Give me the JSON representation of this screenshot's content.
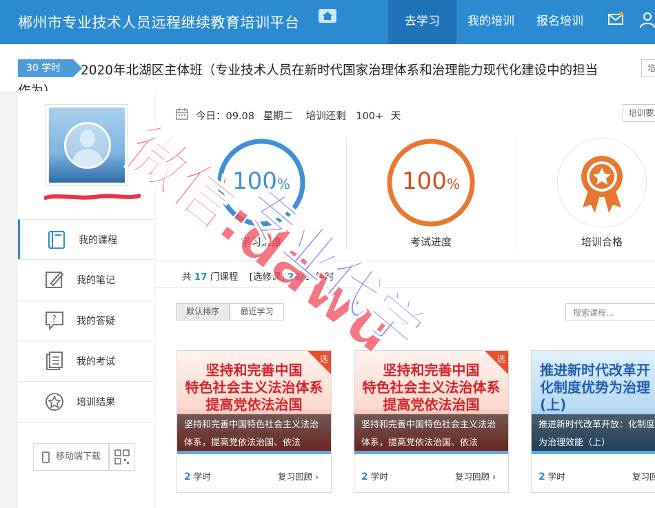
{
  "header": {
    "logo": "郴州市专业技术人员远程继续教育培训平台",
    "nav": [
      {
        "label": "去学习",
        "active": true
      },
      {
        "label": "我的培训",
        "active": false
      },
      {
        "label": "报名培训",
        "active": false
      }
    ]
  },
  "course": {
    "hours_tag": "30 学时",
    "title_line1": "2020年北湖区主体班（专业技术人员在新时代国家治理体系和治理能力现代化建设中的担当",
    "title_line2": "作为）",
    "top_btn": "培"
  },
  "sidebar": {
    "menu": [
      {
        "label": "我的课程",
        "icon": "book-icon",
        "active": true
      },
      {
        "label": "我的笔记",
        "icon": "edit-icon",
        "active": false
      },
      {
        "label": "我的答疑",
        "icon": "question-icon",
        "active": false
      },
      {
        "label": "我的考试",
        "icon": "exam-icon",
        "active": false
      },
      {
        "label": "培训结果",
        "icon": "star-badge-icon",
        "active": false
      }
    ],
    "mobile_download": "移动端下载"
  },
  "summary": {
    "today": "今日：09.08",
    "weekday": "星期二",
    "remaining_label": "培训还剩",
    "remaining_value": "100+",
    "remaining_unit": "天",
    "requirements_btn": "培训要求"
  },
  "stats": {
    "study": {
      "value": "100",
      "unit": "%",
      "label": "学习进度",
      "color": "#3e8fd6",
      "progress": 1.0
    },
    "exam": {
      "value": "100",
      "unit": "%",
      "label": "考试进度",
      "color": "#e8782f",
      "progress": 1.0
    },
    "result": {
      "label": "培训合格",
      "color": "#e8782f"
    }
  },
  "counts": {
    "prefix": "共",
    "courses": "17",
    "courses_unit": "门课程",
    "elective_label": "[选修课]",
    "elective_hours": "28",
    "elective_total": "/28学时"
  },
  "sort": {
    "default": "默认排序",
    "recent": "最近学习"
  },
  "search": {
    "placeholder": "搜索课程..."
  },
  "cards": [
    {
      "poster": "坚持和完善中国\n特色社会主义法治体系\n提高党依法治国",
      "overlay": "坚持和完善中国特色社会主义法治体系，提高党依法治国、依法",
      "elective": "选",
      "hours": "2",
      "hours_unit": "学时",
      "review": "复习回顾",
      "theme": "red"
    },
    {
      "poster": "坚持和完善中国\n特色社会主义法治体系\n提高党依法治国",
      "overlay": "坚持和完善中国特色社会主义法治体系，提高党依法治国、依法",
      "elective": "选",
      "hours": "2",
      "hours_unit": "学时",
      "review": "复习回顾",
      "theme": "red"
    },
    {
      "poster": "推进新时代改革开\n化制度优势为治理\n(上)",
      "overlay": "推进新时代改革开放：化制度优势为治理效能（上）",
      "elective": "",
      "hours": "2",
      "hours_unit": "学时",
      "review": "复习回",
      "theme": "blue"
    }
  ],
  "watermark": {
    "text1": "微信:dawu",
    "text2": "专业代学"
  }
}
